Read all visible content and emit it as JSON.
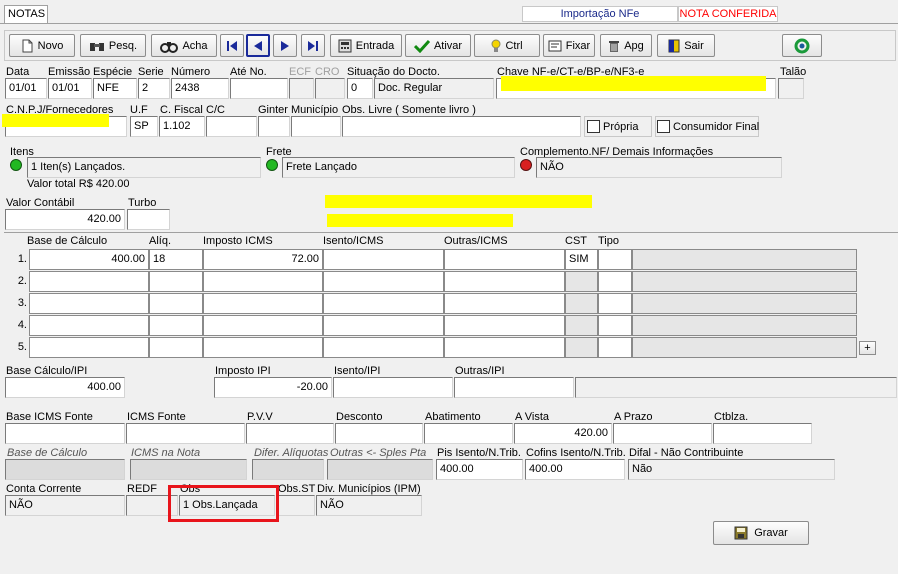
{
  "tab": {
    "label": "NOTAS"
  },
  "header": {
    "import_label": "Importação NFe",
    "status_label": "NOTA CONFERIDA",
    "status_color": "#ff0000"
  },
  "toolbar": {
    "novo": "Novo",
    "pesq": "Pesq.",
    "acha": "Acha",
    "entrada": "Entrada",
    "ativar": "Ativar",
    "ctrl": "Ctrl",
    "fixar": "Fixar",
    "apg": "Apg",
    "sair": "Sair"
  },
  "labels": {
    "data": "Data",
    "emissao": "Emissão",
    "especie": "Espécie",
    "serie": "Serie",
    "numero": "Número",
    "ate_no": "Até No.",
    "ecf": "ECF",
    "cro": "CRO",
    "situacao": "Situação do Docto.",
    "chave": "Chave NF-e/CT-e/BP-e/NF3-e",
    "talao": "Talão",
    "cnpj": "C.N.P.J/Fornecedores",
    "uf": "U.F",
    "cfiscal": "C. Fiscal",
    "cc": "C/C",
    "ginter": "Ginter",
    "municipio": "Município",
    "obs_livre": "Obs. Livre ( Somente livro )",
    "propria": "Própria",
    "consumidor_final": "Consumidor Final",
    "itens": "Itens",
    "frete": "Frete",
    "complemento": "Complemento.NF/ Demais Informações",
    "valor_contabil": "Valor Contábil",
    "turbo": "Turbo",
    "base_calculo": "Base de Cálculo",
    "aliq": "Alíq.",
    "imposto_icms": "Imposto ICMS",
    "isento_icms": "Isento/ICMS",
    "outras_icms": "Outras/ICMS",
    "cst": "CST",
    "tipo": "Tipo",
    "base_ipi": "Base Cálculo/IPI",
    "imposto_ipi": "Imposto IPI",
    "isento_ipi": "Isento/IPI",
    "outras_ipi": "Outras/IPI",
    "base_icms_fonte": "Base ICMS Fonte",
    "icms_fonte": "ICMS Fonte",
    "pvv": "P.V.V",
    "desconto": "Desconto",
    "abatimento": "Abatimento",
    "a_vista": "A Vista",
    "a_prazo": "A Prazo",
    "ctblza": "Ctblza.",
    "base_calculo_it": "Base de Cálculo",
    "icms_na_nota": "ICMS na Nota",
    "difer_aliquotas": "Difer. Alíquotas",
    "outras_sples": "Outras <- Sples Pta",
    "pis_isento": "Pis Isento/N.Trib.",
    "cofins_isento": "Cofins Isento/N.Trib.",
    "difal": "Difal - Não Contribuinte",
    "conta_corrente": "Conta Corrente",
    "redf": "REDF",
    "obs": "Obs",
    "obs_st": "Obs.ST",
    "div_municipios": "Div. Municípios (IPM)"
  },
  "fields": {
    "data": "01/01",
    "emissao": "01/01",
    "especie": "NFE",
    "serie": "2",
    "numero": "2438",
    "situacao_code": "0",
    "situacao_desc": "Doc. Regular",
    "uf": "SP",
    "cfiscal": "1.102",
    "itens_value": "1 Iten(s) Lançados.",
    "frete_value": "Frete Lançado",
    "complemento_value": "NÃO",
    "valor_total": "Valor total R$ 420.00",
    "valor_contabil": "420.00",
    "base_ipi": "400.00",
    "imposto_ipi": "-20.00",
    "a_vista": "420.00",
    "pis_isento": "400.00",
    "cofins_isento": "400.00",
    "difal": "Não",
    "conta_corrente": "NÃO",
    "obs": "1 Obs.Lançada",
    "div_municipios": "NÃO"
  },
  "icms_rows": [
    {
      "num": "1.",
      "base": "400.00",
      "aliq": "18",
      "imposto": "72.00",
      "isento": "",
      "outras": "",
      "cst": "SIM",
      "tipo": ""
    },
    {
      "num": "2.",
      "base": "",
      "aliq": "",
      "imposto": "",
      "isento": "",
      "outras": "",
      "cst": "",
      "tipo": ""
    },
    {
      "num": "3.",
      "base": "",
      "aliq": "",
      "imposto": "",
      "isento": "",
      "outras": "",
      "cst": "",
      "tipo": ""
    },
    {
      "num": "4.",
      "base": "",
      "aliq": "",
      "imposto": "",
      "isento": "",
      "outras": "",
      "cst": "",
      "tipo": ""
    },
    {
      "num": "5.",
      "base": "",
      "aliq": "",
      "imposto": "",
      "isento": "",
      "outras": "",
      "cst": "",
      "tipo": ""
    }
  ],
  "add_row_button": "+",
  "gravar": "Gravar",
  "colors": {
    "highlight_box": "#e8141b",
    "redaction": "#ffff00",
    "led_green": "#22b822",
    "led_red": "#d82020"
  }
}
